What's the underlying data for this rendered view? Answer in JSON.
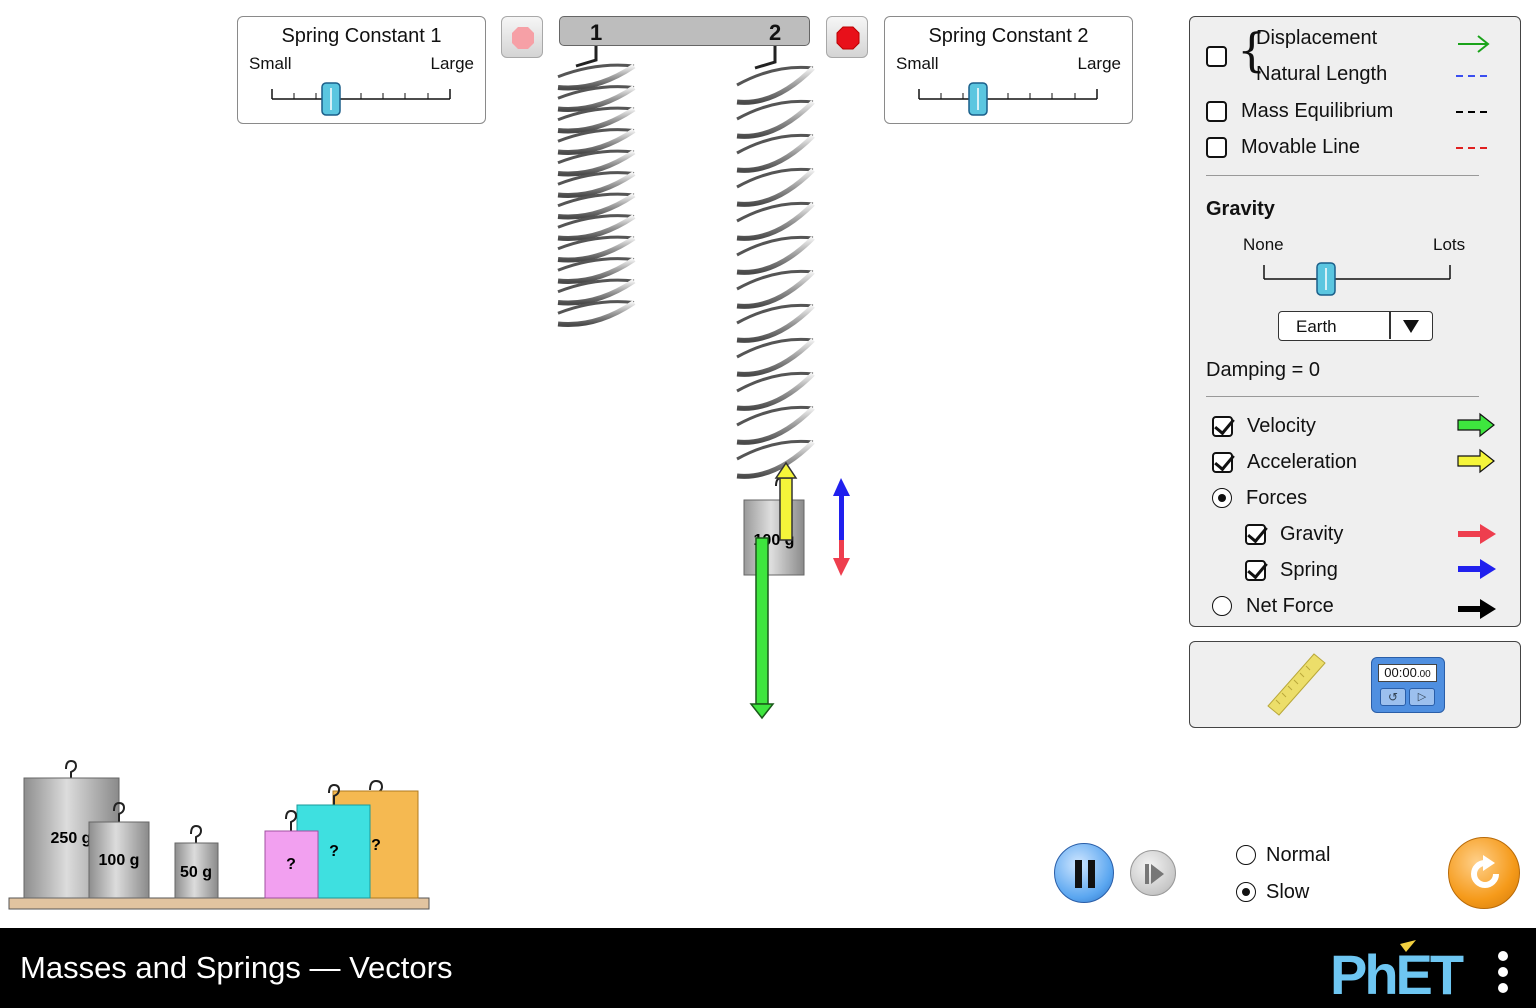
{
  "spring_constant_1": {
    "title": "Spring Constant 1",
    "small": "Small",
    "large": "Large",
    "value": 0.35
  },
  "spring_constant_2": {
    "title": "Spring Constant 2",
    "small": "Small",
    "large": "Large",
    "value": 0.35
  },
  "ceiling": {
    "label_1": "1",
    "label_2": "2"
  },
  "attached_mass": {
    "label": "100 g"
  },
  "options": {
    "displacement": {
      "label": "Displacement",
      "checked": false,
      "color": "#1aa31a"
    },
    "natural_length": {
      "label": "Natural Length",
      "color": "#3a4ef0"
    },
    "mass_equilibrium": {
      "label": "Mass Equilibrium",
      "checked": false,
      "color": "#000000"
    },
    "movable_line": {
      "label": "Movable Line",
      "checked": false,
      "color": "#e02020"
    }
  },
  "gravity": {
    "heading": "Gravity",
    "none": "None",
    "lots": "Lots",
    "value": 0.4,
    "dropdown_value": "Earth",
    "dropdown_icon": "triangle-down-icon"
  },
  "damping": {
    "label": "Damping = 0"
  },
  "vectors": {
    "velocity": {
      "label": "Velocity",
      "checked": true,
      "color": "#3ee63e"
    },
    "acceleration": {
      "label": "Acceleration",
      "checked": true,
      "color": "#f5f53a"
    },
    "forces": {
      "label": "Forces",
      "selected": true
    },
    "gravity": {
      "label": "Gravity",
      "checked": true,
      "color": "#ee3e4e"
    },
    "spring": {
      "label": "Spring",
      "checked": true,
      "color": "#2020ee"
    },
    "net_force": {
      "label": "Net Force",
      "selected": false,
      "color": "#000000"
    }
  },
  "tools": {
    "stopwatch_time": "00:00",
    "stopwatch_hundredths": ".00"
  },
  "masses": [
    {
      "label": "250 g"
    },
    {
      "label": "100 g"
    },
    {
      "label": "50 g"
    },
    {
      "label": "?"
    },
    {
      "label": "?"
    },
    {
      "label": "?"
    }
  ],
  "playback": {
    "normal": "Normal",
    "slow": "Slow",
    "selected": "slow"
  },
  "footer": {
    "title": "Masses and Springs — Vectors",
    "logo": "PhET"
  }
}
